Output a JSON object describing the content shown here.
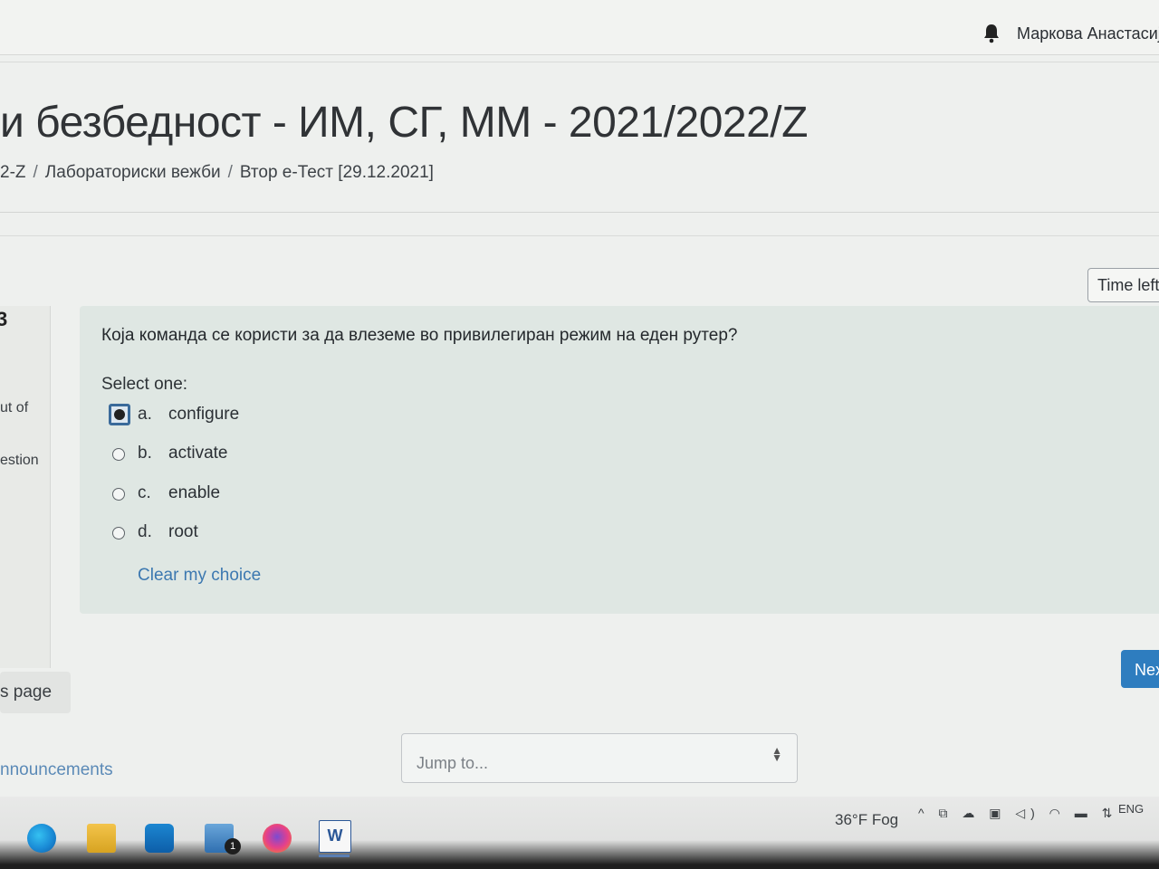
{
  "header": {
    "username": "Маркова Анастасија",
    "bell_icon": "bell-icon"
  },
  "course": {
    "title": "и безбедност - ИМ, СГ, ММ - 2021/2022/Z",
    "breadcrumb": [
      "2-Z",
      "Лабораториски вежби",
      "Втор е-Тест [29.12.2021]"
    ]
  },
  "timer": {
    "label": "Time left"
  },
  "question_info": {
    "number": "3",
    "out_of": "ut of",
    "flag": "estion"
  },
  "question": {
    "text": "Која команда се користи за да влеземе во привилегиран режим на еден рутер?",
    "select_one": "Select one:",
    "options": [
      {
        "letter": "a.",
        "text": "configure",
        "selected": true
      },
      {
        "letter": "b.",
        "text": "activate",
        "selected": false
      },
      {
        "letter": "c.",
        "text": "enable",
        "selected": false
      },
      {
        "letter": "d.",
        "text": "root",
        "selected": false
      }
    ],
    "clear_choice": "Clear my choice"
  },
  "navigation": {
    "next": "Nex",
    "previous": "s page"
  },
  "footer": {
    "announcements": "nnouncements",
    "jump_placeholder": "Jump to..."
  },
  "taskbar": {
    "apps": [
      "edge-icon",
      "file-explorer-icon",
      "store-icon",
      "mail-icon",
      "firefox-icon",
      "word-icon"
    ],
    "mail_badge": "1",
    "word_label": "W",
    "weather": "36°F  Fog",
    "tray": "^ ⧉ ☁ ▣ ◁) ◠ ▬ ⇅",
    "language": "ENG"
  }
}
